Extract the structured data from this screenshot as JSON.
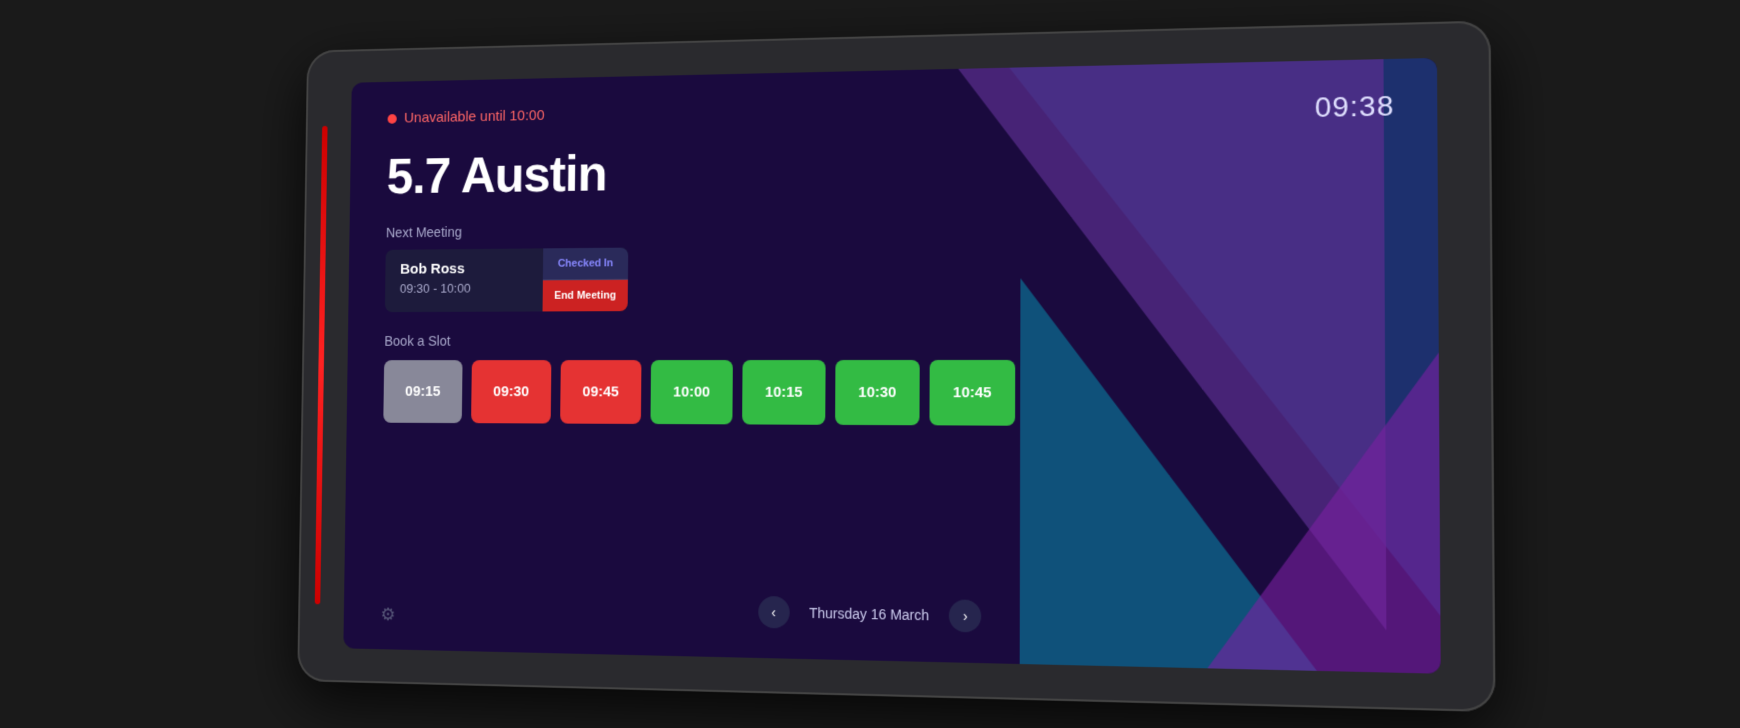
{
  "screen": {
    "status": {
      "dot_color": "#ff4444",
      "text": "Unavailable until 10:00"
    },
    "time": "09:38",
    "room_name": "5.7 Austin",
    "next_meeting": {
      "label": "Next Meeting",
      "name": "Bob Ross",
      "time_range": "09:30 - 10:00",
      "checked_in_label": "Checked In",
      "end_meeting_label": "End Meeting"
    },
    "book_slot": {
      "label": "Book a Slot",
      "slots": [
        {
          "time": "09:15",
          "type": "gray"
        },
        {
          "time": "09:30",
          "type": "red"
        },
        {
          "time": "09:45",
          "type": "red"
        },
        {
          "time": "10:00",
          "type": "green"
        },
        {
          "time": "10:15",
          "type": "green"
        },
        {
          "time": "10:30",
          "type": "green"
        },
        {
          "time": "10:45",
          "type": "green"
        }
      ]
    },
    "navigation": {
      "prev_label": "‹",
      "next_label": "›",
      "date": "Thursday 16 March"
    },
    "settings_icon": "⚙"
  }
}
